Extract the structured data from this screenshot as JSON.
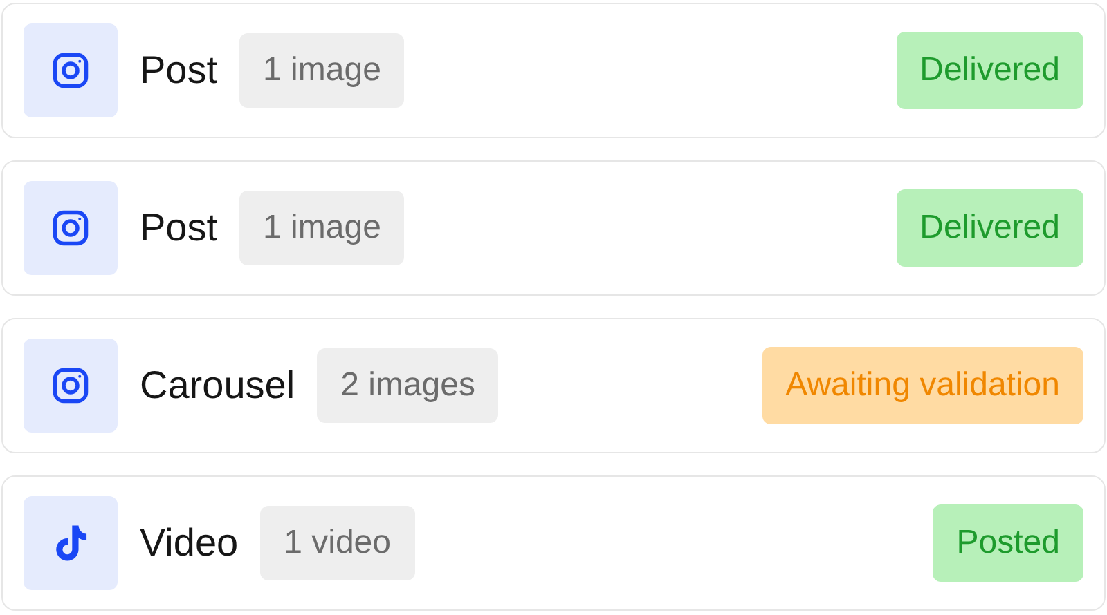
{
  "items": [
    {
      "kind": "instagram",
      "title": "Post",
      "count": "1 image",
      "status": {
        "label": "Delivered",
        "kind": "done"
      }
    },
    {
      "kind": "instagram",
      "title": "Post",
      "count": "1 image",
      "status": {
        "label": "Delivered",
        "kind": "done"
      }
    },
    {
      "kind": "instagram",
      "title": "Carousel",
      "count": "2 images",
      "status": {
        "label": "Awaiting validation",
        "kind": "pending"
      }
    },
    {
      "kind": "tiktok",
      "title": "Video",
      "count": "1 video",
      "status": {
        "label": "Posted",
        "kind": "done"
      }
    }
  ]
}
